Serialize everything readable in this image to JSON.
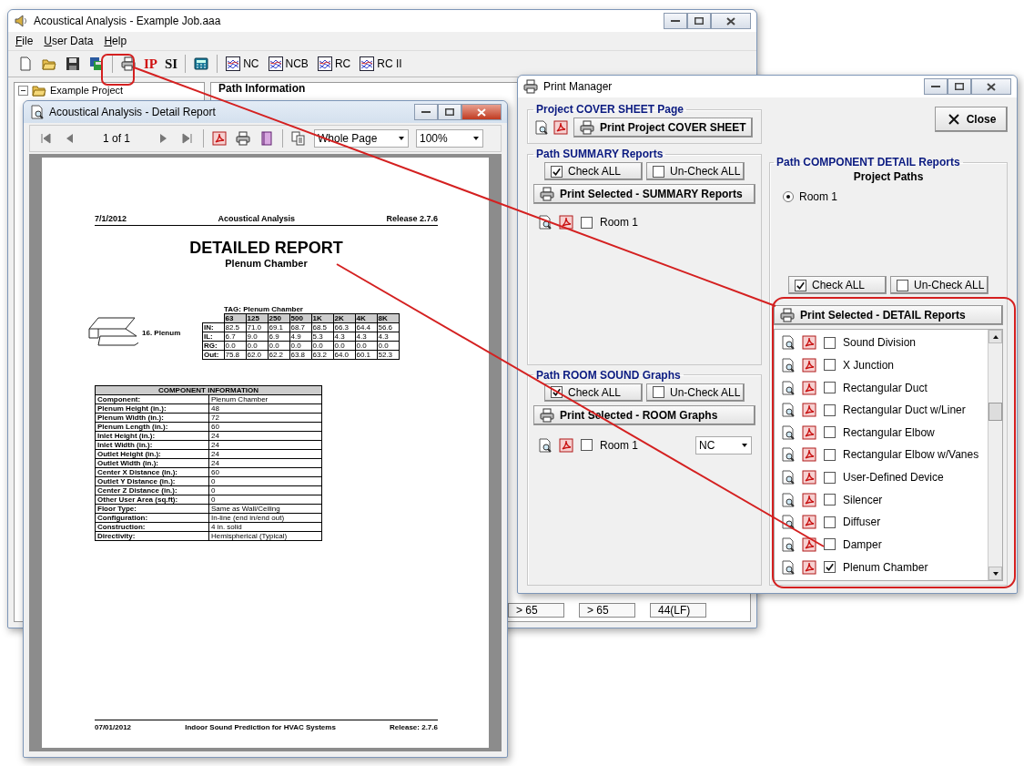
{
  "main_window": {
    "title": "Acoustical Analysis - Example Job.aaa",
    "menu": [
      "File",
      "User Data",
      "Help"
    ],
    "units": [
      {
        "label": "IP",
        "selected": true
      },
      {
        "label": "SI",
        "selected": false
      }
    ],
    "chart_buttons": [
      "NC",
      "NCB",
      "RC",
      "RC II"
    ],
    "tree": [
      {
        "label": "Example Project",
        "expanded": true
      }
    ],
    "panel_heading": "Path Information",
    "footer_cells": [
      "> 65",
      "> 65",
      "44(LF)"
    ]
  },
  "report_window": {
    "title": "Acoustical Analysis - Detail Report",
    "page_indicator": "1 of 1",
    "view_select": "Whole Page",
    "zoom_select": "100%",
    "page": {
      "date": "7/1/2012",
      "app_name": "Acoustical Analysis",
      "release": "Release 2.7.6",
      "heading": "DETAILED REPORT",
      "subheading": "Plenum Chamber",
      "component_label": "16. Plenum",
      "tag": "TAG: Plenum Chamber",
      "bands": [
        "63",
        "125",
        "250",
        "500",
        "1K",
        "2K",
        "4K",
        "8K"
      ],
      "band_rows": [
        {
          "label": "IN:",
          "values": [
            "82.5",
            "71.0",
            "69.1",
            "68.7",
            "68.5",
            "66.3",
            "64.4",
            "56.6"
          ]
        },
        {
          "label": "IL:",
          "values": [
            "6.7",
            "9.0",
            "6.9",
            "4.9",
            "5.3",
            "4.3",
            "4.3",
            "4.3"
          ]
        },
        {
          "label": "RG:",
          "values": [
            "0.0",
            "0.0",
            "0.0",
            "0.0",
            "0.0",
            "0.0",
            "0.0",
            "0.0"
          ]
        },
        {
          "label": "Out:",
          "values": [
            "75.8",
            "62.0",
            "62.2",
            "63.8",
            "63.2",
            "64.0",
            "60.1",
            "52.3"
          ]
        }
      ],
      "info_title": "COMPONENT INFORMATION",
      "info_rows": [
        [
          "Component:",
          "Plenum Chamber"
        ],
        [
          "Plenum Height (in.):",
          "48"
        ],
        [
          "Plenum Width (in.):",
          "72"
        ],
        [
          "Plenum Length (in.):",
          "60"
        ],
        [
          "Inlet Height (in.):",
          "24"
        ],
        [
          "Inlet Width (in.):",
          "24"
        ],
        [
          "Outlet Height (in.):",
          "24"
        ],
        [
          "Outlet Width (in.):",
          "24"
        ],
        [
          "Center X Distance (in.):",
          "60"
        ],
        [
          "Outlet Y Distance (in.):",
          "0"
        ],
        [
          "Center Z Distance (in.):",
          "0"
        ],
        [
          "Other User Area (sq.ft):",
          "0"
        ],
        [
          "Floor Type:",
          "Same as Wall/Ceiling"
        ],
        [
          "Configuration:",
          "In-line (end in/end out)"
        ],
        [
          "Construction:",
          "4 in. solid"
        ],
        [
          "Directivity:",
          "Hemispherical (Typical)"
        ]
      ],
      "footer_date": "07/01/2012",
      "footer_title": "Indoor Sound Prediction for HVAC Systems",
      "footer_release": "Release: 2.7.6"
    }
  },
  "print_manager": {
    "title": "Print Manager",
    "close": "Close",
    "cover": {
      "title": "Project COVER SHEET Page",
      "print_button": "Print Project COVER SHEET"
    },
    "summary": {
      "title": "Path SUMMARY Reports",
      "check_all": {
        "label": "Check ALL",
        "checked": true
      },
      "uncheck_all": {
        "label": "Un-Check ALL",
        "checked": false
      },
      "print_button": "Print Selected - SUMMARY Reports",
      "items": [
        {
          "label": "Room 1",
          "checked": false
        }
      ]
    },
    "room": {
      "title": "Path ROOM SOUND Graphs",
      "check_all": {
        "label": "Check ALL",
        "checked": true
      },
      "uncheck_all": {
        "label": "Un-Check ALL",
        "checked": false
      },
      "print_button": "Print Selected - ROOM Graphs",
      "items": [
        {
          "label": "Room 1",
          "checked": false
        }
      ],
      "graph_select": "NC"
    },
    "detail": {
      "title": "Path COMPONENT DETAIL Reports",
      "subtitle": "Project Paths",
      "paths": [
        {
          "label": "Room 1",
          "selected": true
        }
      ],
      "check_all": {
        "label": "Check ALL",
        "checked": true
      },
      "uncheck_all": {
        "label": "Un-Check ALL",
        "checked": false
      },
      "print_button": "Print Selected - DETAIL Reports",
      "items": [
        {
          "label": "Sound Division",
          "checked": false
        },
        {
          "label": "X Junction",
          "checked": false
        },
        {
          "label": "Rectangular Duct",
          "checked": false
        },
        {
          "label": "Rectangular Duct w/Liner",
          "checked": false
        },
        {
          "label": "Rectangular Elbow",
          "checked": false
        },
        {
          "label": "Rectangular Elbow w/Vanes",
          "checked": false
        },
        {
          "label": "User-Defined Device",
          "checked": false
        },
        {
          "label": "Silencer",
          "checked": false
        },
        {
          "label": "Diffuser",
          "checked": false
        },
        {
          "label": "Damper",
          "checked": false
        },
        {
          "label": "Plenum Chamber",
          "checked": true
        }
      ]
    }
  }
}
